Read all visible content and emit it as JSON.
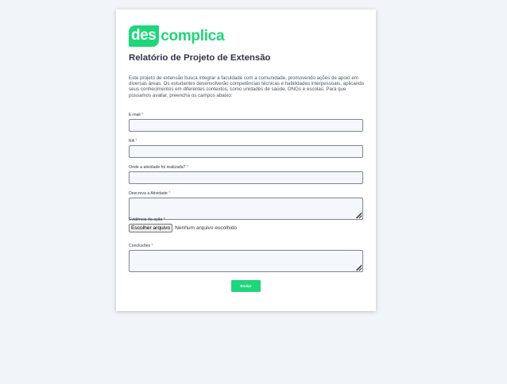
{
  "logo": {
    "box_text": "des",
    "text": "complica",
    "brand_color": "#1fd67b"
  },
  "form": {
    "title": "Relatório de Projeto de Extensão",
    "intro": "Este projeto de extensão busca integrar a faculdade com a comunidade, promovendo ações de apoio em diversas áreas. Os estudantes desenvolverão competências técnicas e habilidades interpessoais, aplicando seus conhecimentos em diferentes contextos, como unidades de saúde, ONGs e escolas. Para que possamos avaliar, preencha os campos abaixo:",
    "required_marker": "*",
    "fields": {
      "email": {
        "label": "E-mail",
        "value": ""
      },
      "ra": {
        "label": "RA",
        "value": ""
      },
      "location": {
        "label": "Onde a atividade foi realizada?",
        "value": ""
      },
      "description": {
        "label": "Descreva a Atividade",
        "value": ""
      },
      "evidence": {
        "label": "Evidência da ação",
        "button_label": "Escolher arquivo",
        "status": "Nenhum arquivo escolhido"
      },
      "conclusions": {
        "label": "Conclusões",
        "value": ""
      }
    },
    "submit_label": "Enviar"
  }
}
